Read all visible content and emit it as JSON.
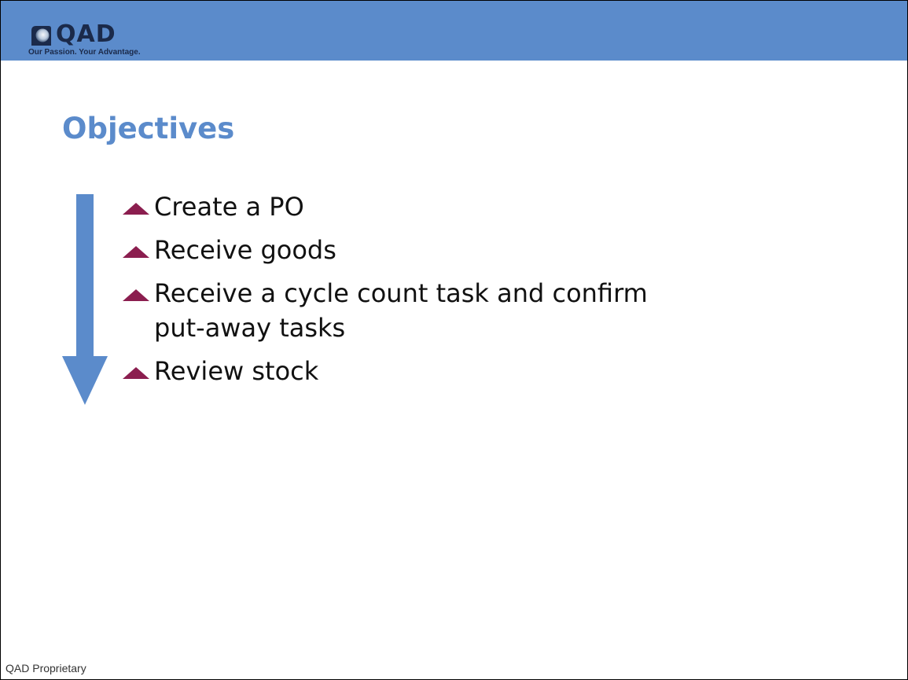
{
  "header": {
    "logo_text": "QAD",
    "tagline": "Our Passion. Your Advantage.",
    "band_color": "#5b8bcb"
  },
  "slide": {
    "title": "Objectives",
    "title_color": "#5b8bcb",
    "arrow_color": "#5b8bcb",
    "arrow_direction": "down",
    "bullet_marker_color": "#8b1e4f",
    "bullets": [
      {
        "text": "Create a PO"
      },
      {
        "text": "Receive goods"
      },
      {
        "text": "Receive a cycle count task and confirm put-away tasks"
      },
      {
        "text": "Review stock"
      }
    ]
  },
  "footer": {
    "text": "QAD Proprietary"
  }
}
